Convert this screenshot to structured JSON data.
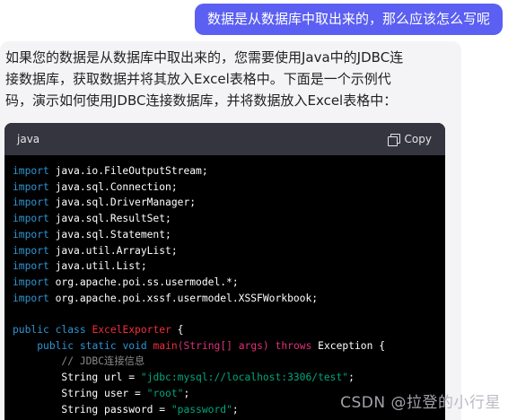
{
  "user_message": "数据是从数据库中取出来的，那么应该怎么写呢",
  "answer": {
    "lines": [
      "如果您的数据是从数据库中取出来的，您需要使用Java中的JDBC连",
      "接数据库，获取数据并将其放入Excel表格中。下面是一个示例代",
      "码，演示如何使用JDBC连接数据库，并将数据放入Excel表格中："
    ]
  },
  "code_block": {
    "language": "java",
    "copy_label": "Copy",
    "copy_icon": "copy-icon",
    "lines": [
      [
        [
          "kw",
          "import"
        ],
        [
          "p",
          " java.io.FileOutputStream;"
        ]
      ],
      [
        [
          "kw",
          "import"
        ],
        [
          "p",
          " java.sql.Connection;"
        ]
      ],
      [
        [
          "kw",
          "import"
        ],
        [
          "p",
          " java.sql.DriverManager;"
        ]
      ],
      [
        [
          "kw",
          "import"
        ],
        [
          "p",
          " java.sql.ResultSet;"
        ]
      ],
      [
        [
          "kw",
          "import"
        ],
        [
          "p",
          " java.sql.Statement;"
        ]
      ],
      [
        [
          "kw",
          "import"
        ],
        [
          "p",
          " java.util.ArrayList;"
        ]
      ],
      [
        [
          "kw",
          "import"
        ],
        [
          "p",
          " java.util.List;"
        ]
      ],
      [
        [
          "kw",
          "import"
        ],
        [
          "p",
          " org.apache.poi.ss.usermodel.*;"
        ]
      ],
      [
        [
          "kw",
          "import"
        ],
        [
          "p",
          " org.apache.poi.xssf.usermodel.XSSFWorkbook;"
        ]
      ],
      [],
      [
        [
          "kw",
          "public"
        ],
        [
          "p",
          " "
        ],
        [
          "kw",
          "class"
        ],
        [
          "p",
          " "
        ],
        [
          "fn",
          "ExcelExporter"
        ],
        [
          "p",
          " {"
        ]
      ],
      [
        [
          "p",
          "    "
        ],
        [
          "kw",
          "public"
        ],
        [
          "p",
          " "
        ],
        [
          "kw",
          "static"
        ],
        [
          "p",
          " "
        ],
        [
          "kw",
          "void"
        ],
        [
          "p",
          " "
        ],
        [
          "fn",
          "main"
        ],
        [
          "ty",
          "(String[] args)"
        ],
        [
          "p",
          " "
        ],
        [
          "ty",
          "throws"
        ],
        [
          "p",
          " Exception {"
        ]
      ],
      [
        [
          "p",
          "        "
        ],
        [
          "cm",
          "// JDBC连接信息"
        ]
      ],
      [
        [
          "p",
          "        String "
        ],
        [
          "p",
          "url"
        ],
        [
          "p",
          " = "
        ],
        [
          "str",
          "\"jdbc:mysql://localhost:3306/test\""
        ],
        [
          "p",
          ";"
        ]
      ],
      [
        [
          "p",
          "        String "
        ],
        [
          "p",
          "user"
        ],
        [
          "p",
          " = "
        ],
        [
          "str",
          "\"root\""
        ],
        [
          "p",
          ";"
        ]
      ],
      [
        [
          "p",
          "        String "
        ],
        [
          "p",
          "password"
        ],
        [
          "p",
          " = "
        ],
        [
          "str",
          "\"password\""
        ],
        [
          "p",
          ";"
        ]
      ]
    ]
  },
  "watermark": "CSDN @拉登的小行星"
}
